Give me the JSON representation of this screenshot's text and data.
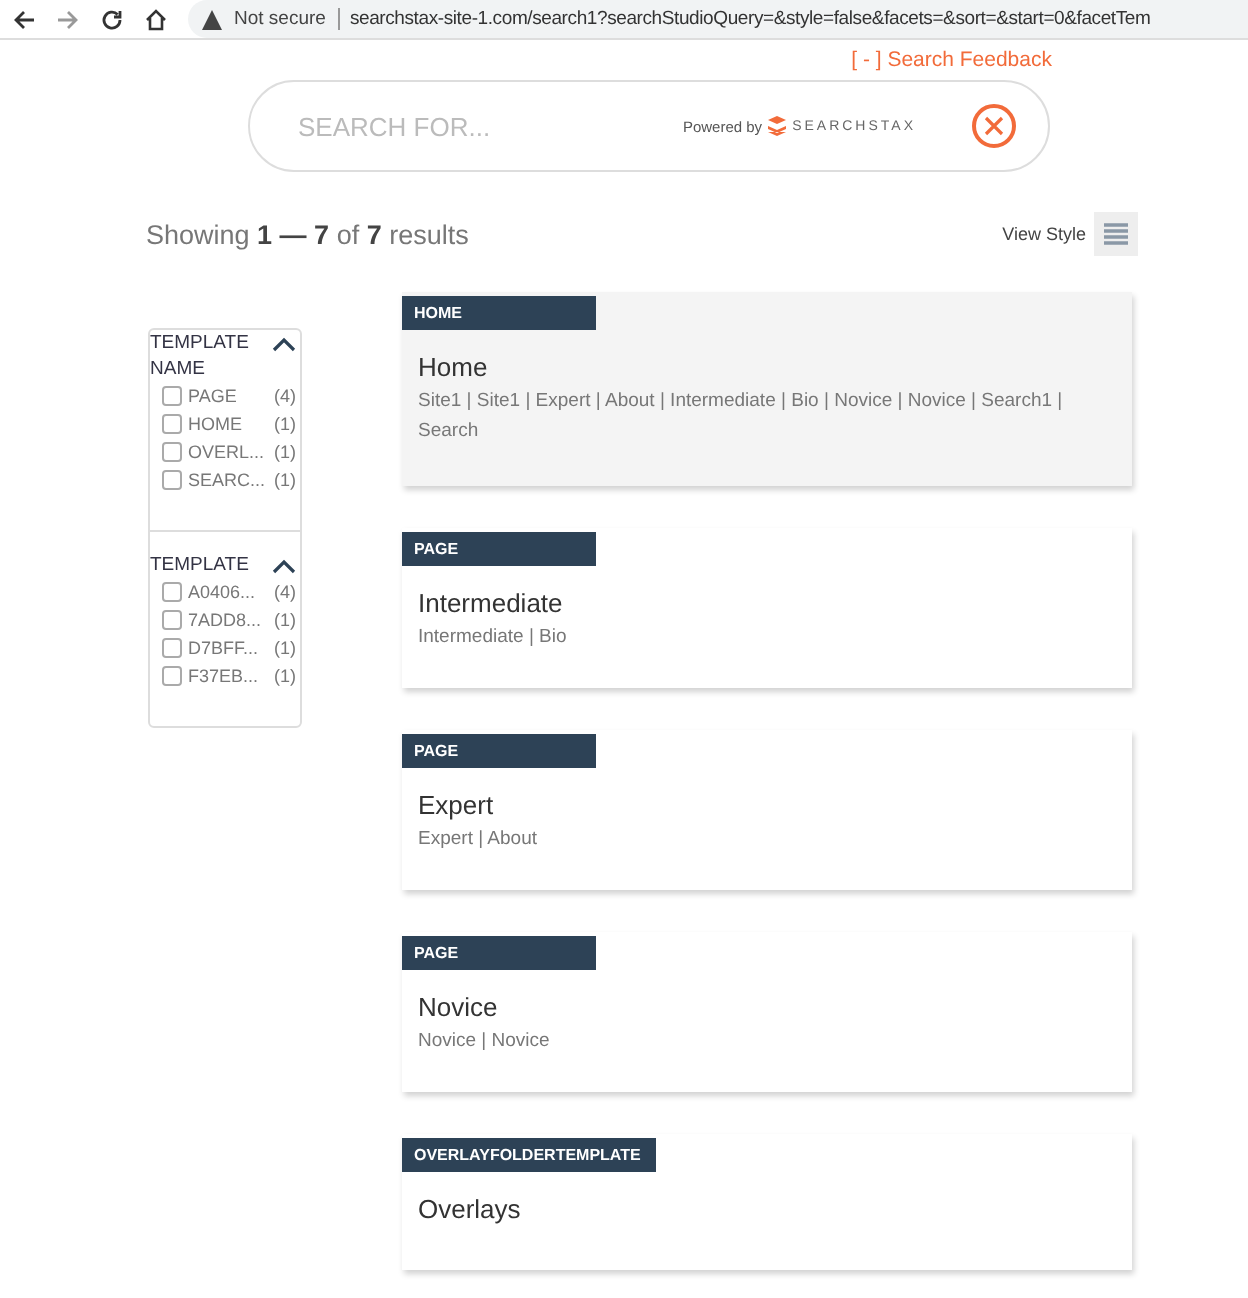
{
  "browser": {
    "security": "Not secure",
    "url": "searchstax-site-1.com/search1?searchStudioQuery=&style=false&facets=&sort=&start=0&facetTem"
  },
  "feedback_link": "[ - ] Search Feedback",
  "search": {
    "placeholder": "SEARCH FOR...",
    "powered_by": "Powered by",
    "brand": "SEARCHSTAX"
  },
  "summary": "Showing **1 — 7** of **7** results",
  "view_style": "View Style",
  "facets": [
    {
      "title": "TEMPLATE NAME",
      "expanded": true,
      "items": [
        {
          "label": "PAGE",
          "count": "(4)",
          "checked": false
        },
        {
          "label": "HOME",
          "count": "(1)",
          "checked": false
        },
        {
          "label": "OVERL...",
          "count": "(1)",
          "checked": false
        },
        {
          "label": "SEARC...",
          "count": "(1)",
          "checked": false
        }
      ]
    },
    {
      "title": "TEMPLATE",
      "expanded": true,
      "items": [
        {
          "label": "A0406...",
          "count": "(4)",
          "checked": false
        },
        {
          "label": "7ADD8...",
          "count": "(1)",
          "checked": false
        },
        {
          "label": "D7BFF...",
          "count": "(1)",
          "checked": false
        },
        {
          "label": "F37EB...",
          "count": "(1)",
          "checked": false
        }
      ]
    }
  ],
  "results": [
    {
      "tag": "HOME",
      "title": "Home",
      "snippet": "Site1 | Site1 | Expert | About | Intermediate | Bio | Novice | Novice | Search1 | Search",
      "selected": true
    },
    {
      "tag": "PAGE",
      "title": "Intermediate",
      "snippet": "Intermediate | Bio",
      "selected": false
    },
    {
      "tag": "PAGE",
      "title": "Expert",
      "snippet": "Expert | About",
      "selected": false
    },
    {
      "tag": "PAGE",
      "title": "Novice",
      "snippet": "Novice | Novice",
      "selected": false
    },
    {
      "tag": "OVERLAYFOLDERTEMPLATE",
      "title": "Overlays",
      "selected": false
    }
  ]
}
